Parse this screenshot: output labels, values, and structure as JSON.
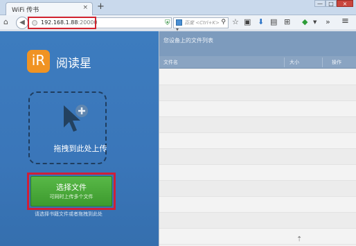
{
  "browser": {
    "tab_title": "WiFi 传书",
    "tab_close": "×",
    "new_tab": "+",
    "window_controls": {
      "minimize": "—",
      "maximize": "□",
      "close": "×"
    },
    "url_host": "192.168.1.88",
    "url_port": ":20000",
    "search_placeholder": "百度 <Ctrl+K>",
    "accent_highlight_color": "#d1232f"
  },
  "app": {
    "logo_glyph": "iR",
    "title": "阅读星"
  },
  "upload": {
    "drop_label": "拖拽到此处上传",
    "choose_button_label": "选择文件",
    "choose_button_sub": "可同时上传多个文件",
    "bottom_note": "请选择书籍文件或者拖拽到此处"
  },
  "file_list": {
    "caption": "您设备上的文件列表",
    "columns": [
      "文件名",
      "大小",
      "操作"
    ],
    "rows": 11
  },
  "icons": {
    "home": "home-icon",
    "back": "back-arrow-icon",
    "reload": "reload-icon",
    "search": "search-icon",
    "star": "bookmark-star-icon",
    "download": "download-icon",
    "menu": "hamburger-menu-icon",
    "cursor_plus": "cursor-plus-icon"
  }
}
